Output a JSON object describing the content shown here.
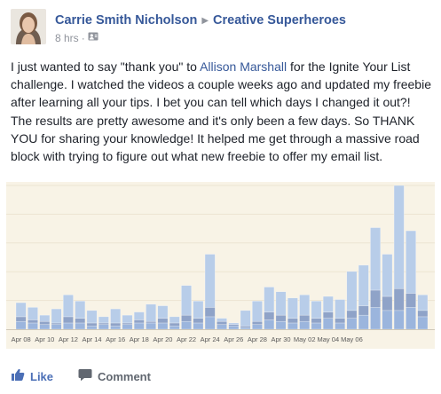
{
  "post": {
    "author": "Carrie Smith Nicholson",
    "group": "Creative Superheroes",
    "time": "8 hrs",
    "dot": "·",
    "text_before": "I just wanted to say \"thank you\" to ",
    "mention": "Allison Marshall",
    "text_after": " for the Ignite Your List challenge. I watched the videos a couple weeks ago and updated my freebie after learning all your tips. I bet you can tell which days I changed it out?! The results are pretty awesome and it's only been a few days. So THANK YOU for sharing your knowledge! It helped me get through a massive road block with trying to figure out what new freebie to offer my email list."
  },
  "actions": {
    "like": "Like",
    "comment": "Comment"
  },
  "colors": {
    "link": "#365899",
    "chart_bg": "#f8f3e6",
    "bar_light": "#b8cde9",
    "bar_mid": "#9bb5dd",
    "bar_dark": "#8fa3c8"
  },
  "icons": {
    "privacy": "group-privacy-icon",
    "like": "thumbs-up-icon",
    "comment": "speech-bubble-icon"
  },
  "chart_data": {
    "type": "bar",
    "stacked": true,
    "tick_labels": [
      "Apr 08",
      "Apr 10",
      "Apr 12",
      "Apr 14",
      "Apr 16",
      "Apr 18",
      "Apr 20",
      "Apr 22",
      "Apr 24",
      "Apr 26",
      "Apr 28",
      "Apr 30",
      "May 02",
      "May 04",
      "May 06"
    ],
    "series": [
      {
        "values": [
          5,
          4,
          3,
          3,
          4,
          4,
          2,
          3,
          2,
          3,
          4,
          4,
          4,
          2,
          5,
          4,
          8,
          3,
          2,
          1,
          3,
          6,
          5,
          4,
          5,
          4,
          7,
          4,
          7,
          9,
          14,
          12,
          12,
          14,
          8
        ]
      },
      {
        "values": [
          3,
          2,
          2,
          1,
          4,
          3,
          2,
          1,
          2,
          1,
          2,
          1,
          3,
          2,
          4,
          3,
          6,
          2,
          1,
          1,
          2,
          5,
          4,
          3,
          4,
          3,
          4,
          3,
          5,
          6,
          11,
          9,
          14,
          9,
          4
        ]
      },
      {
        "values": [
          9,
          8,
          4,
          9,
          14,
          11,
          8,
          4,
          9,
          5,
          5,
          11,
          8,
          4,
          19,
          11,
          34,
          2,
          1,
          10,
          13,
          16,
          15,
          13,
          13,
          11,
          10,
          12,
          25,
          26,
          40,
          27,
          66,
          40,
          10
        ]
      }
    ]
  }
}
